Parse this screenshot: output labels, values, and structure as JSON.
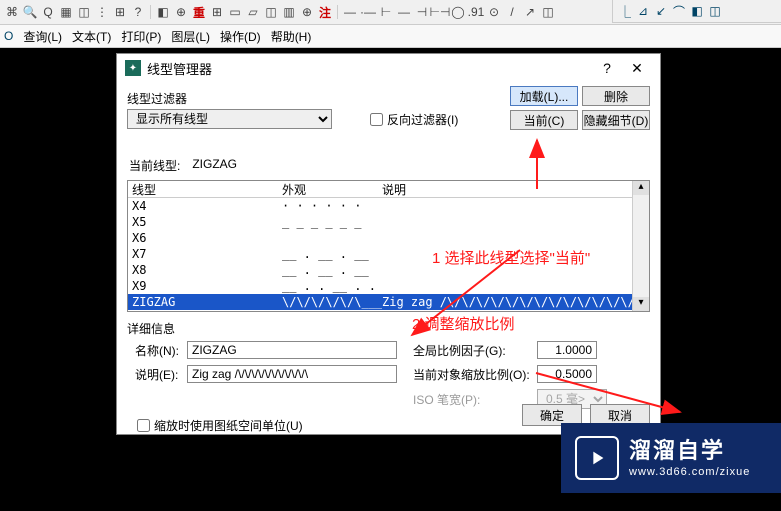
{
  "toolbar_icons": [
    "⌘",
    "🔍",
    "Q",
    "▦",
    "◫",
    "⋮",
    "⊞",
    "?",
    "◧",
    "⊕",
    "重",
    "⊞",
    "▭",
    "▱",
    "◫",
    "▥",
    "⊕",
    "注",
    "—",
    "·—",
    "⊢",
    "—",
    "⊣",
    "⊢⊣",
    "◯",
    ".91",
    "⊙",
    "/",
    "↗",
    "◫"
  ],
  "right_icons": [
    "⎿",
    "⊿",
    "↙",
    "⌒",
    "◧",
    "◫"
  ],
  "menu": [
    "查询(L)",
    "文本(T)",
    "打印(P)",
    "图层(L)",
    "操作(D)",
    "帮助(H)"
  ],
  "dialog": {
    "title": "线型管理器",
    "help": "?",
    "close": "✕",
    "filter_label": "线型过滤器",
    "filter_value": "显示所有线型",
    "invert_filter": "反向过滤器(I)",
    "btn_load": "加载(L)...",
    "btn_delete": "删除",
    "btn_current": "当前(C)",
    "btn_hide": "隐藏细节(D)",
    "current_label": "当前线型:",
    "current_value": "ZIGZAG",
    "col_name": "线型",
    "col_appearance": "外观",
    "col_desc": "说明",
    "rows": [
      {
        "name": "X4",
        "appearance": "·  ·  ·  ·  ·  ·",
        "desc": ""
      },
      {
        "name": "X5",
        "appearance": "_ _ _ _ _ _",
        "desc": ""
      },
      {
        "name": "X6",
        "appearance": "",
        "desc": ""
      },
      {
        "name": "X7",
        "appearance": "__ . __ . __",
        "desc": ""
      },
      {
        "name": "X8",
        "appearance": "__ . __ . __",
        "desc": ""
      },
      {
        "name": "X9",
        "appearance": "__ . . __ . .",
        "desc": ""
      },
      {
        "name": "ZIGZAG",
        "appearance": "\\/\\/\\/\\/\\/\\____",
        "desc": "Zig zag /\\/\\/\\/\\/\\/\\/\\/\\/\\/\\/\\/\\/\\/\\"
      }
    ],
    "details_label": "详细信息",
    "name_label": "名称(N):",
    "name_value": "ZIGZAG",
    "desc_label": "说明(E):",
    "desc_value": "Zig zag /\\/\\/\\/\\/\\/\\/\\/\\/\\/\\/\\",
    "global_label": "全局比例因子(G):",
    "global_value": "1.0000",
    "objscale_label": "当前对象缩放比例(O):",
    "objscale_value": "0.5000",
    "pspace_chk": "缩放时使用图纸空间单位(U)",
    "iso_label": "ISO 笔宽(P):",
    "iso_value": "0.5 毫>",
    "ok": "确定",
    "cancel": "取消"
  },
  "annotations": {
    "step1": "1  选择此线型选择\"当前\"",
    "step2": "2   调整缩放比例"
  },
  "watermark": {
    "big": "溜溜自学",
    "small": "www.3d66.com/zixue"
  }
}
